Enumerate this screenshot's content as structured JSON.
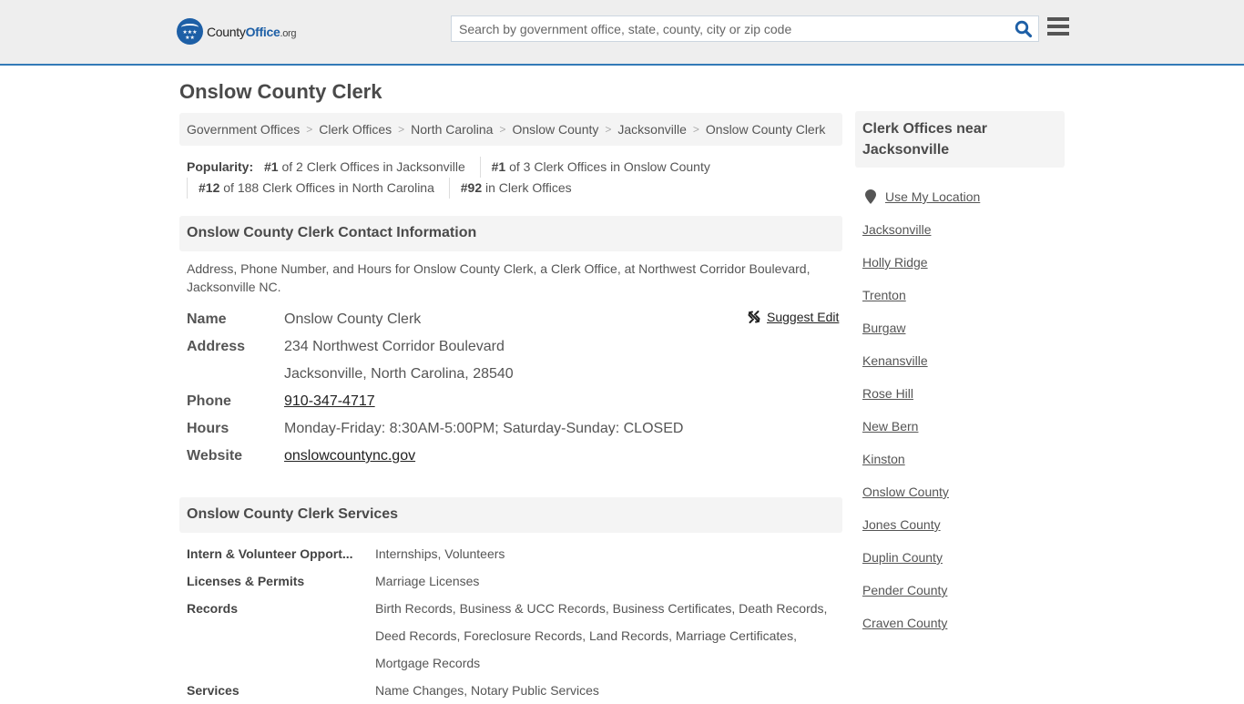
{
  "header": {
    "logo": {
      "name_part1": "County",
      "name_part2": "Office",
      "name_part3": ".org"
    },
    "search": {
      "placeholder": "Search by government office, state, county, city or zip code",
      "value": ""
    }
  },
  "page": {
    "title": "Onslow County Clerk"
  },
  "breadcrumb": [
    "Government Offices",
    "Clerk Offices",
    "North Carolina",
    "Onslow County",
    "Jacksonville",
    "Onslow County Clerk"
  ],
  "popularity": {
    "label": "Popularity:",
    "items": [
      {
        "rank": "#1",
        "text": " of 2 Clerk Offices in Jacksonville"
      },
      {
        "rank": "#1",
        "text": " of 3 Clerk Offices in Onslow County"
      },
      {
        "rank": "#12",
        "text": " of 188 Clerk Offices in North Carolina"
      },
      {
        "rank": "#92",
        "text": " in Clerk Offices"
      }
    ]
  },
  "contact": {
    "heading": "Onslow County Clerk Contact Information",
    "description": "Address, Phone Number, and Hours for Onslow County Clerk, a Clerk Office, at Northwest Corridor Boulevard, Jacksonville NC.",
    "suggest_edit": "Suggest Edit",
    "rows": {
      "name": {
        "label": "Name",
        "value": "Onslow County Clerk"
      },
      "address": {
        "label": "Address",
        "line1": "234 Northwest Corridor Boulevard",
        "line2": "Jacksonville, North Carolina, 28540"
      },
      "phone": {
        "label": "Phone",
        "value": "910-347-4717"
      },
      "hours": {
        "label": "Hours",
        "value": "Monday-Friday: 8:30AM-5:00PM; Saturday-Sunday: CLOSED"
      },
      "website": {
        "label": "Website",
        "value": "onslowcountync.gov"
      }
    }
  },
  "services": {
    "heading": "Onslow County Clerk Services",
    "rows": [
      {
        "label": "Intern & Volunteer Opport...",
        "value": "Internships, Volunteers"
      },
      {
        "label": "Licenses & Permits",
        "value": "Marriage Licenses"
      },
      {
        "label": "Records",
        "value": "Birth Records, Business & UCC Records, Business Certificates, Death Records, Deed Records, Foreclosure Records, Land Records, Marriage Certificates, Mortgage Records"
      },
      {
        "label": "Services",
        "value": "Name Changes, Notary Public Services"
      }
    ]
  },
  "sidebar": {
    "heading": "Clerk Offices near Jacksonville",
    "use_location": "Use My Location",
    "links": [
      "Jacksonville",
      "Holly Ridge",
      "Trenton",
      "Burgaw",
      "Kenansville",
      "Rose Hill",
      "New Bern",
      "Kinston",
      "Onslow County",
      "Jones County",
      "Duplin County",
      "Pender County",
      "Craven County"
    ]
  },
  "colors": {
    "accent": "#337ab7",
    "logo_blue": "#1d5fa6",
    "search_icon": "#1d5fa6"
  }
}
